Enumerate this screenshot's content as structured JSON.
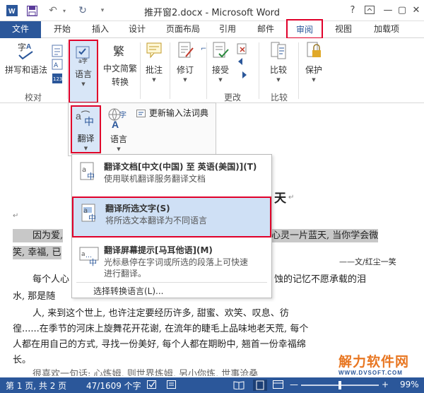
{
  "window": {
    "title": "推开窗2.docx - Microsoft Word",
    "help": "?",
    "minimize": "—",
    "restore": "▢",
    "close": "✕"
  },
  "tabs": {
    "file": "文件",
    "items": [
      "开始",
      "插入",
      "设计",
      "页面布局",
      "引用",
      "邮件",
      "审阅",
      "视图",
      "加载项"
    ],
    "active": "审阅"
  },
  "ribbon": {
    "spelling": "拼写和语法",
    "language": "语言",
    "chinese_convert_1": "中文简繁",
    "chinese_convert_2": "转换",
    "comment": "批注",
    "track": "修订",
    "accept": "接受",
    "compare": "比较",
    "protect": "保护",
    "group_proof": "校对",
    "group_changes": "更改",
    "group_compare": "比较"
  },
  "lang_menu": {
    "translate": "翻译",
    "language": "语言",
    "update_ime": "更新输入法词典"
  },
  "translate_dropdown": {
    "items": [
      {
        "title": "翻译文档[中文(中国) 至 英语(美国)](T)",
        "desc": "使用联机翻译服务翻译文档"
      },
      {
        "title": "翻译所选文字(S)",
        "desc": "将所选文本翻译为不同语言"
      },
      {
        "title": "翻译屏幕提示[马耳他语](M)",
        "desc": "光标悬停在字词或所选的段落上可快速",
        "desc2": "进行翻译。"
      }
    ],
    "footer": "选择转换语言(L)..."
  },
  "document": {
    "heading_fragment": "天",
    "hl_line1_left": "因为爱,",
    "hl_line1_right": "心灵一片蓝天, 当你学会微",
    "hl_line2_left": "笑, 幸福, 已",
    "attribution": "——文/红尘一笑",
    "p1_left": "每个人心",
    "p1_right": "蚀的记忆不愿承载的泪",
    "p1b_left": "水, 那是随",
    "p2": "人, 来到这个世上, 也许注定要经历许多, 甜蜜、欢笑、叹息、彷",
    "p3": "徨......在季节的河床上旋舞花开花谢, 在流年的睫毛上品味地老天荒, 每个",
    "p4": "人都在用自己的方式, 寻找一份美好, 每个人都在期盼中, 翘首一份幸福绵",
    "p5": "长。",
    "p6": "很喜欢一句话: 心炼姆, 则世界炼姆, 另小你炼, 世事沧桑"
  },
  "status": {
    "page": "第 1 页, 共 2 页",
    "words": "47/1609 个字",
    "zoom": "99%",
    "zoom_minus": "—",
    "zoom_plus": "+"
  },
  "watermark": {
    "name": "解力软件网",
    "url": "WWW.DVSOFT.COM"
  },
  "colors": {
    "accent": "#2b579a",
    "highlight_border": "#e0002a",
    "selection": "#cfe0f5"
  }
}
